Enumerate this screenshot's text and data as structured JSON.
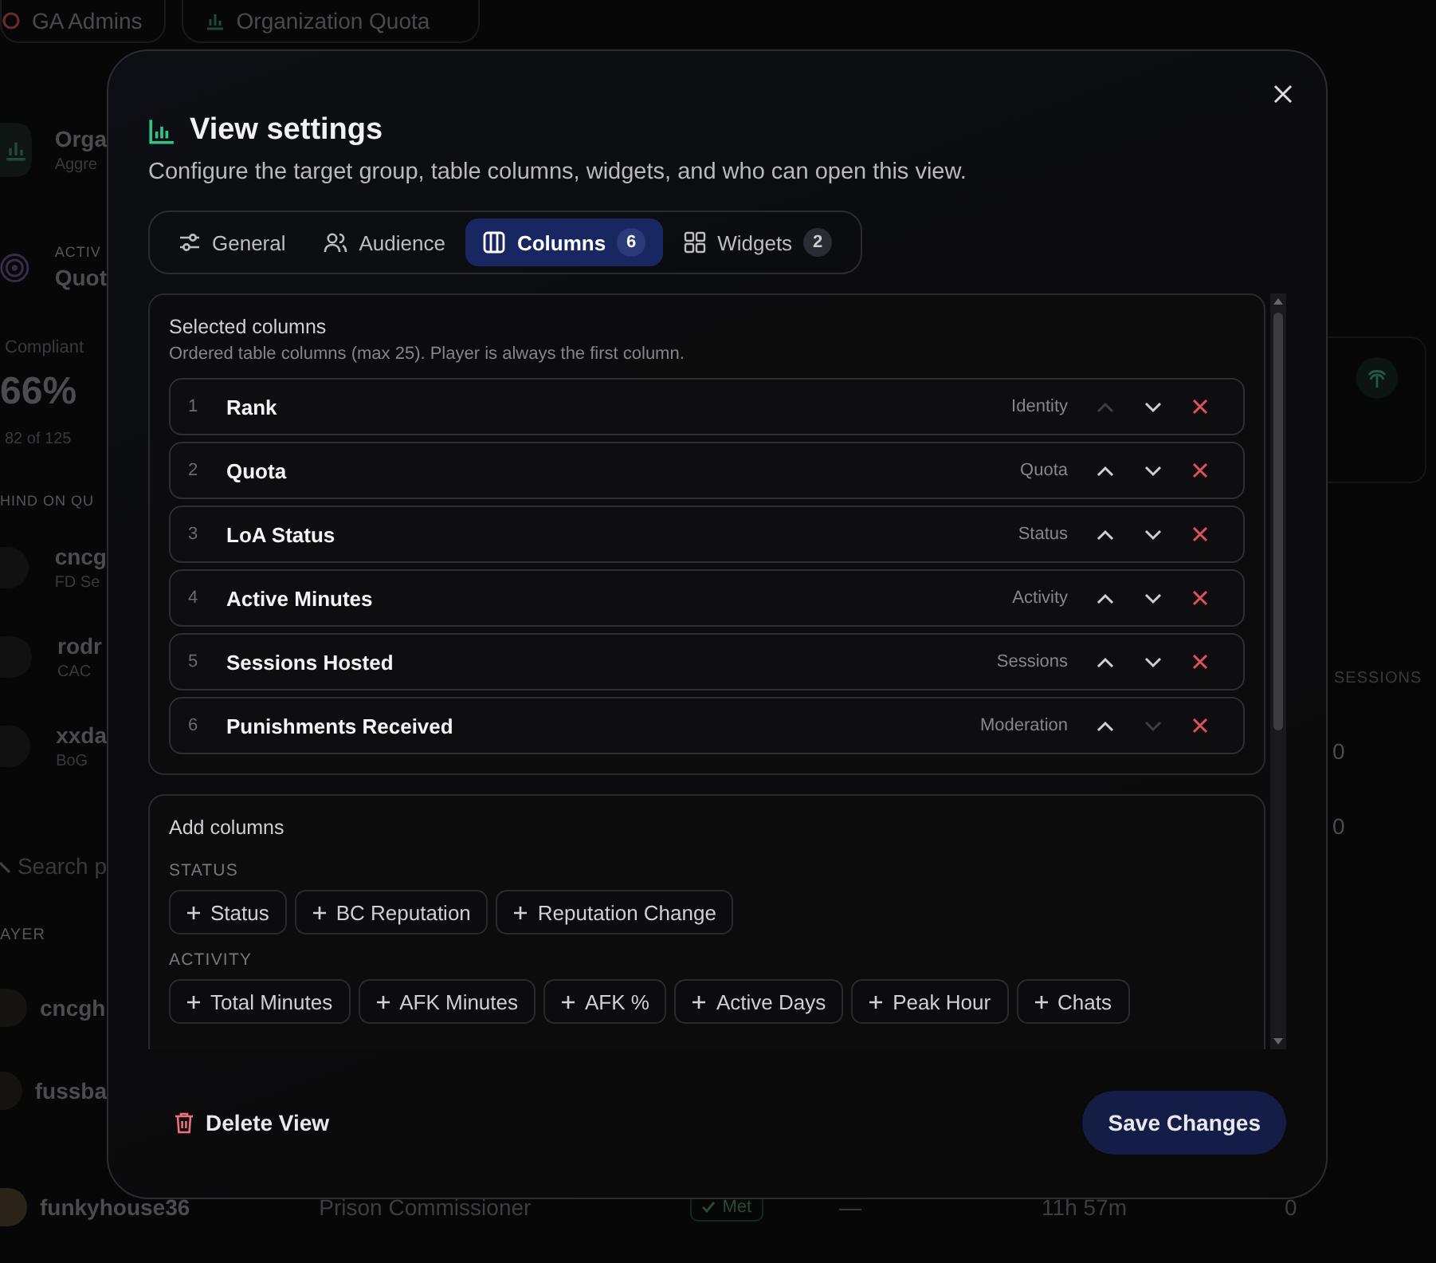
{
  "background": {
    "top_tabs": [
      {
        "label": "GA Admins",
        "kind": "group"
      },
      {
        "label": "Organization Quota",
        "kind": "view"
      }
    ],
    "left": {
      "card_title": "Orga",
      "card_subtitle": "Aggre",
      "active_label": "ACTIV",
      "active_value": "Quot",
      "compliant_label": "Compliant",
      "compliant_value": "66%",
      "compliant_detail": "82 of 125",
      "behind_label": "HIND ON QU",
      "behind": [
        {
          "name": "cncg",
          "role": "FD Se"
        },
        {
          "name": "rodr",
          "role": "CAC"
        },
        {
          "name": "xxda",
          "role": "BoG"
        }
      ],
      "search_placeholder": "Search p",
      "player_header": "AYER",
      "players": [
        {
          "name": "cncgh"
        },
        {
          "name": "fussba"
        }
      ]
    },
    "right": {
      "sessions_header": "SESSIONS",
      "values": [
        "0",
        "0"
      ]
    },
    "bottom_row": {
      "player": "funkyhouse36",
      "rank": "Prison Commissioner",
      "quota": "Met",
      "loa": "—",
      "active": "11h 57m",
      "sessions": "0"
    }
  },
  "dialog": {
    "title": "View settings",
    "subtitle": "Configure the target group, table columns, widgets, and who can open this view.",
    "tabs": [
      {
        "label": "General",
        "kind": "general",
        "selected": false
      },
      {
        "label": "Audience",
        "kind": "audience",
        "selected": false
      },
      {
        "label": "Columns",
        "kind": "columns",
        "selected": true,
        "count": "6"
      },
      {
        "label": "Widgets",
        "kind": "widgets",
        "selected": false,
        "count": "2"
      }
    ],
    "selected_columns": {
      "title": "Selected columns",
      "description": "Ordered table columns (max 25). Player is always the first column.",
      "rows": [
        {
          "index": "1",
          "name": "Rank",
          "category": "Identity",
          "up_disabled": true,
          "down_disabled": false
        },
        {
          "index": "2",
          "name": "Quota",
          "category": "Quota",
          "up_disabled": false,
          "down_disabled": false
        },
        {
          "index": "3",
          "name": "LoA Status",
          "category": "Status",
          "up_disabled": false,
          "down_disabled": false
        },
        {
          "index": "4",
          "name": "Active Minutes",
          "category": "Activity",
          "up_disabled": false,
          "down_disabled": false
        },
        {
          "index": "5",
          "name": "Sessions Hosted",
          "category": "Sessions",
          "up_disabled": false,
          "down_disabled": false
        },
        {
          "index": "6",
          "name": "Punishments Received",
          "category": "Moderation",
          "up_disabled": false,
          "down_disabled": true
        }
      ]
    },
    "add_columns": {
      "title": "Add columns",
      "groups": [
        {
          "label": "STATUS",
          "items": [
            "Status",
            "BC Reputation",
            "Reputation Change"
          ]
        },
        {
          "label": "ACTIVITY",
          "items": [
            "Total Minutes",
            "AFK Minutes",
            "AFK %",
            "Active Days",
            "Peak Hour",
            "Chats"
          ]
        }
      ]
    },
    "delete_button": "Delete View",
    "save_button": "Save Changes"
  }
}
